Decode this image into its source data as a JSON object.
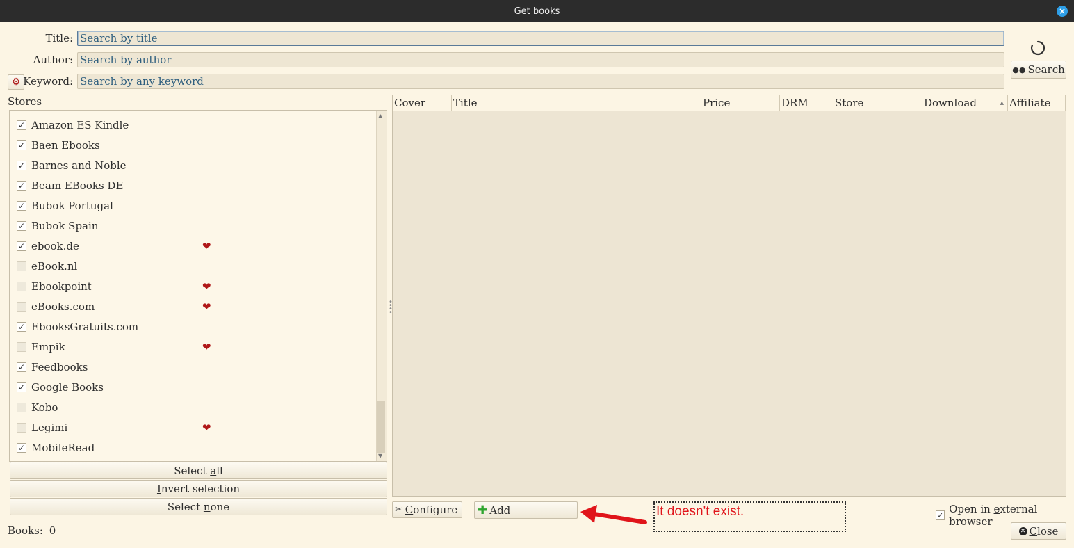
{
  "window": {
    "title": "Get books"
  },
  "search": {
    "title_label": "Title:",
    "title_placeholder": "Search by title",
    "author_label": "Author:",
    "author_placeholder": "Search by author",
    "keyword_label": "Keyword:",
    "keyword_placeholder": "Search by any keyword",
    "search_button": "Search"
  },
  "stores": {
    "label": "Stores",
    "items": [
      {
        "name": "Amazon ES Kindle",
        "checked": true,
        "heart": false
      },
      {
        "name": "Baen Ebooks",
        "checked": true,
        "heart": false
      },
      {
        "name": "Barnes and Noble",
        "checked": true,
        "heart": false
      },
      {
        "name": "Beam EBooks DE",
        "checked": true,
        "heart": false
      },
      {
        "name": "Bubok Portugal",
        "checked": true,
        "heart": false
      },
      {
        "name": "Bubok Spain",
        "checked": true,
        "heart": false
      },
      {
        "name": "ebook.de",
        "checked": true,
        "heart": true
      },
      {
        "name": "eBook.nl",
        "checked": false,
        "heart": false
      },
      {
        "name": "Ebookpoint",
        "checked": false,
        "heart": true
      },
      {
        "name": "eBooks.com",
        "checked": false,
        "heart": true
      },
      {
        "name": "EbooksGratuits.com",
        "checked": true,
        "heart": false
      },
      {
        "name": "Empik",
        "checked": false,
        "heart": true
      },
      {
        "name": "Feedbooks",
        "checked": true,
        "heart": false
      },
      {
        "name": "Google Books",
        "checked": true,
        "heart": false
      },
      {
        "name": "Kobo",
        "checked": false,
        "heart": false
      },
      {
        "name": "Legimi",
        "checked": false,
        "heart": true
      },
      {
        "name": "MobileRead",
        "checked": true,
        "heart": false
      }
    ],
    "select_all_pre": "Select ",
    "select_all_u": "a",
    "select_all_post": "ll",
    "invert_u": "I",
    "invert_post": "nvert selection",
    "select_none_pre": "Select ",
    "select_none_u": "n",
    "select_none_post": "one"
  },
  "results": {
    "columns": [
      "Cover",
      "Title",
      "Price",
      "DRM",
      "Store",
      "Download",
      "Affiliate"
    ]
  },
  "bottom": {
    "configure_u": "C",
    "configure_post": "onfigure",
    "add_label": "Add",
    "annotation": "It doesn't exist.",
    "open_external_pre": "Open in ",
    "open_external_u": "e",
    "open_external_post": "xternal browser",
    "open_external_checked": true,
    "books_label": "Books:",
    "books_count": "0",
    "close_u": "C",
    "close_post": "lose"
  },
  "colors": {
    "heart": "#b01818",
    "annotation": "#e0141a",
    "arrow": "#e0141a"
  }
}
